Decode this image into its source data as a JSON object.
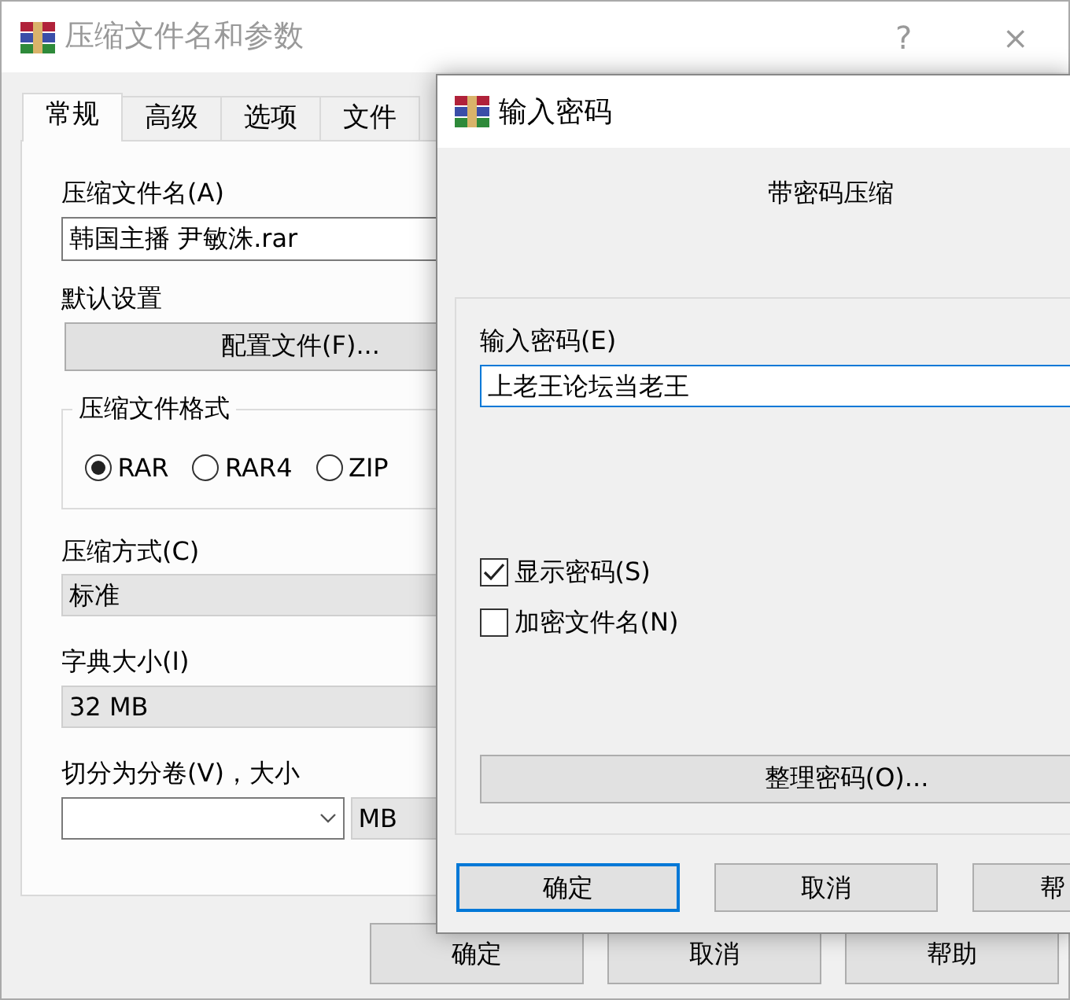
{
  "main_window": {
    "title": "压缩文件名和参数",
    "help_glyph": "?",
    "close_glyph": "×",
    "tabs": [
      {
        "label": "常规",
        "selected": true
      },
      {
        "label": "高级",
        "selected": false
      },
      {
        "label": "选项",
        "selected": false
      },
      {
        "label": "文件",
        "selected": false
      }
    ],
    "archive_name": {
      "label": "压缩文件名(A)",
      "value": "韩国主播 尹敏洙.rar"
    },
    "default_settings": {
      "label": "默认设置",
      "button": "配置文件(F)..."
    },
    "archive_format": {
      "label": "压缩文件格式",
      "options": [
        {
          "label": "RAR",
          "selected": true
        },
        {
          "label": "RAR4",
          "selected": false
        },
        {
          "label": "ZIP",
          "selected": false
        }
      ]
    },
    "compression_method": {
      "label": "压缩方式(C)",
      "value": "标准"
    },
    "dictionary_size": {
      "label": "字典大小(I)",
      "value": "32 MB"
    },
    "split_volumes": {
      "label": "切分为分卷(V)，大小",
      "unit": "MB"
    },
    "buttons": [
      "确定",
      "取消",
      "帮助"
    ]
  },
  "password_dialog": {
    "title": "输入密码",
    "heading": "带密码压缩",
    "password": {
      "label": "输入密码(E)",
      "value": "上老王论坛当老王"
    },
    "checkboxes": [
      {
        "label": "显示密码(S)",
        "checked": true
      },
      {
        "label": "加密文件名(N)",
        "checked": false
      }
    ],
    "organize_button": "整理密码(O)...",
    "buttons": [
      {
        "label": "确定",
        "focused": true
      },
      {
        "label": "取消",
        "focused": false
      },
      {
        "label": "帮",
        "focused": false
      }
    ]
  }
}
